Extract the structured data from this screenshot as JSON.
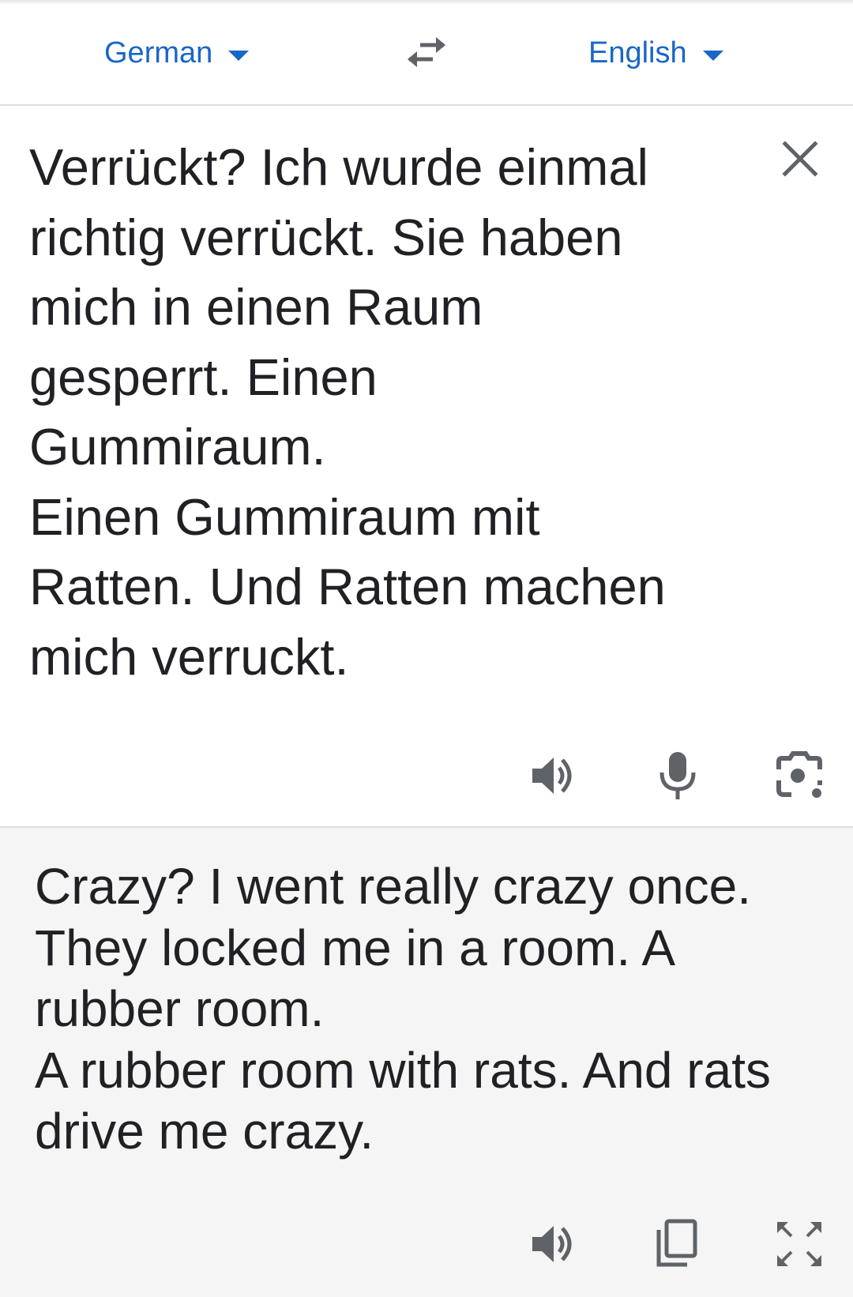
{
  "language_bar": {
    "source_language": "German",
    "target_language": "English",
    "swap_icon": "swap-arrows-icon",
    "accent_color": "#1a66c7"
  },
  "source_panel": {
    "text": "Verrückt? Ich wurde einmal\nrichtig verrückt. Sie haben\nmich in einen Raum\ngesperrt. Einen\nGummiraum.\nEinen Gummiraum mit\nRatten. Und Ratten machen\nmich verruckt.",
    "clear_icon": "close-icon",
    "actions": [
      "speaker-icon",
      "microphone-icon",
      "camera-icon"
    ]
  },
  "translation_panel": {
    "text": "Crazy? I went really crazy once.\nThey locked me in a room. A\nrubber room.\nA rubber room with rats. And rats\ndrive me crazy.",
    "background": "#f4f5f4",
    "actions": [
      "speaker-icon",
      "copy-icon",
      "fullscreen-icon"
    ]
  }
}
